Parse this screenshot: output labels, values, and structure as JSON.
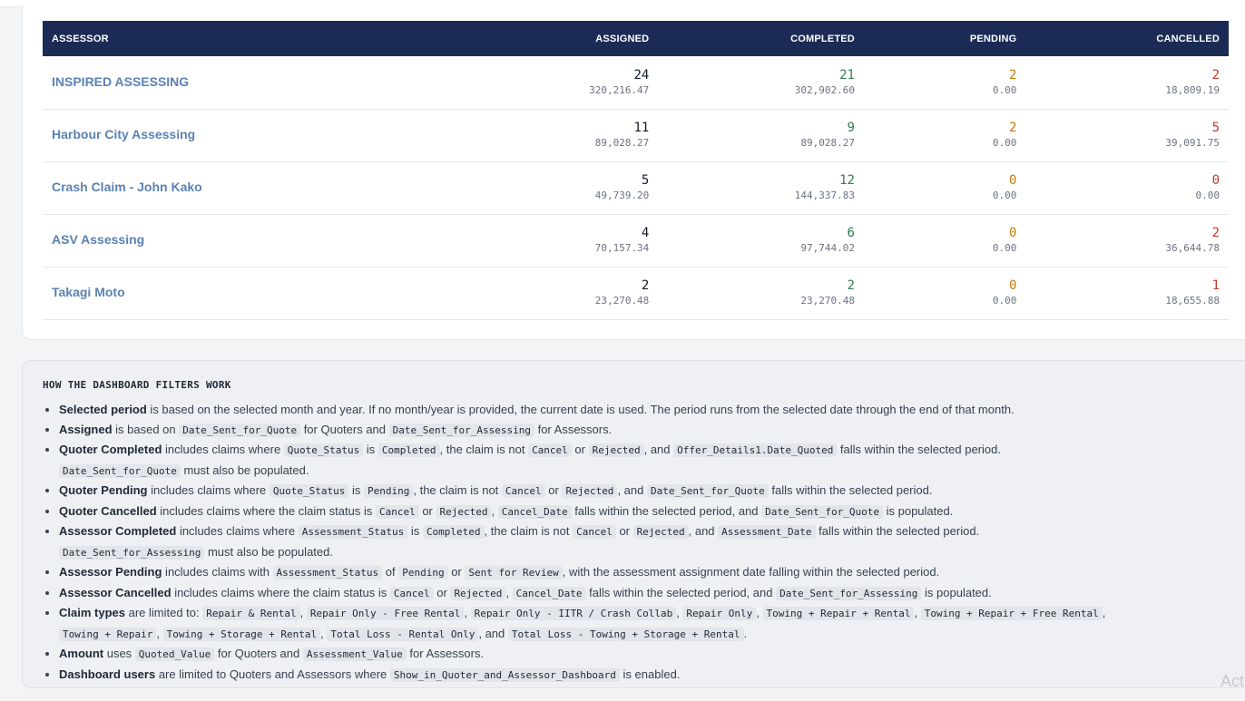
{
  "table": {
    "headers": {
      "assessor": "ASSESSOR",
      "assigned": "ASSIGNED",
      "completed": "COMPLETED",
      "pending": "PENDING",
      "cancelled": "CANCELLED"
    },
    "rows": [
      {
        "name": "INSPIRED ASSESSING",
        "assigned": {
          "count": "24",
          "amount": "320,216.47"
        },
        "completed": {
          "count": "21",
          "amount": "302,902.60"
        },
        "pending": {
          "count": "2",
          "amount": "0.00"
        },
        "cancelled": {
          "count": "2",
          "amount": "18,809.19"
        }
      },
      {
        "name": "Harbour City Assessing",
        "assigned": {
          "count": "11",
          "amount": "89,028.27"
        },
        "completed": {
          "count": "9",
          "amount": "89,028.27"
        },
        "pending": {
          "count": "2",
          "amount": "0.00"
        },
        "cancelled": {
          "count": "5",
          "amount": "39,091.75"
        }
      },
      {
        "name": "Crash Claim - John Kako",
        "assigned": {
          "count": "5",
          "amount": "49,739.20"
        },
        "completed": {
          "count": "12",
          "amount": "144,337.83"
        },
        "pending": {
          "count": "0",
          "amount": "0.00"
        },
        "cancelled": {
          "count": "0",
          "amount": "0.00"
        }
      },
      {
        "name": "ASV Assessing",
        "assigned": {
          "count": "4",
          "amount": "70,157.34"
        },
        "completed": {
          "count": "6",
          "amount": "97,744.02"
        },
        "pending": {
          "count": "0",
          "amount": "0.00"
        },
        "cancelled": {
          "count": "2",
          "amount": "36,644.78"
        }
      },
      {
        "name": "Takagi Moto",
        "assigned": {
          "count": "2",
          "amount": "23,270.48"
        },
        "completed": {
          "count": "2",
          "amount": "23,270.48"
        },
        "pending": {
          "count": "0",
          "amount": "0.00"
        },
        "cancelled": {
          "count": "1",
          "amount": "18,655.88"
        }
      }
    ]
  },
  "info": {
    "title": "HOW THE DASHBOARD FILTERS WORK",
    "rules": {
      "selected_period": {
        "label": "Selected period",
        "text": " is based on the selected month and year. If no month/year is provided, the current date is used. The period runs from the selected date through the end of that month."
      },
      "assigned": {
        "label": "Assigned",
        "t1": " is based on ",
        "c1": "Date_Sent_for_Quote",
        "t2": " for Quoters and ",
        "c2": "Date_Sent_for_Assessing",
        "t3": " for Assessors."
      },
      "quoter_completed": {
        "label": "Quoter Completed",
        "t1": " includes claims where ",
        "c1": "Quote_Status",
        "t2": " is ",
        "c2": "Completed",
        "t3": ", the claim is not ",
        "c3": "Cancel",
        "t4": " or ",
        "c4": "Rejected",
        "t5": ", and ",
        "c5": "Offer_Details1.Date_Quoted",
        "t6": " falls within the selected period.",
        "c6": "Date_Sent_for_Quote",
        "t7": " must also be populated."
      },
      "quoter_pending": {
        "label": "Quoter Pending",
        "t1": " includes claims where ",
        "c1": "Quote_Status",
        "t2": " is ",
        "c2": "Pending",
        "t3": ", the claim is not ",
        "c3": "Cancel",
        "t4": " or ",
        "c4": "Rejected",
        "t5": ", and ",
        "c5": "Date_Sent_for_Quote",
        "t6": " falls within the selected period."
      },
      "quoter_cancelled": {
        "label": "Quoter Cancelled",
        "t1": " includes claims where the claim status is ",
        "c1": "Cancel",
        "t2": " or ",
        "c2": "Rejected",
        "t3": ", ",
        "c3": "Cancel_Date",
        "t4": " falls within the selected period, and ",
        "c4": "Date_Sent_for_Quote",
        "t5": " is populated."
      },
      "assessor_completed": {
        "label": "Assessor Completed",
        "t1": " includes claims where ",
        "c1": "Assessment_Status",
        "t2": " is ",
        "c2": "Completed",
        "t3": ", the claim is not ",
        "c3": "Cancel",
        "t4": " or ",
        "c4": "Rejected",
        "t5": ", and ",
        "c5": "Assessment_Date",
        "t6": " falls within the selected period.",
        "c6": "Date_Sent_for_Assessing",
        "t7": " must also be populated."
      },
      "assessor_pending": {
        "label": "Assessor Pending",
        "t1": " includes claims with ",
        "c1": "Assessment_Status",
        "t2": " of ",
        "c2": "Pending",
        "t3": " or ",
        "c3": "Sent for Review",
        "t4": ", with the assessment assignment date falling within the selected period."
      },
      "assessor_cancelled": {
        "label": "Assessor Cancelled",
        "t1": " includes claims where the claim status is ",
        "c1": "Cancel",
        "t2": " or ",
        "c2": "Rejected",
        "t3": ", ",
        "c3": "Cancel_Date",
        "t4": " falls within the selected period, and ",
        "c4": "Date_Sent_for_Assessing",
        "t5": " is populated."
      },
      "claim_types": {
        "label": "Claim types",
        "t1": " are limited to: ",
        "c1": "Repair & Rental",
        "c2": "Repair Only - Free Rental",
        "c3": "Repair Only - IITR / Crash Collab",
        "c4": "Repair Only",
        "c5": "Towing + Repair + Rental",
        "c6": "Towing + Repair + Free Rental",
        "c7": "Towing + Repair",
        "c8": "Towing + Storage + Rental",
        "c9": "Total Loss - Rental Only",
        "c10": "Total Loss - Towing + Storage + Rental",
        "sep": ", ",
        "and": ", and ",
        "end": "."
      },
      "amount": {
        "label": "Amount",
        "t1": " uses ",
        "c1": "Quoted_Value",
        "t2": " for Quoters and ",
        "c2": "Assessment_Value",
        "t3": " for Assessors."
      },
      "dashboard_users": {
        "label": "Dashboard users",
        "t1": " are limited to Quoters and Assessors where ",
        "c1": "Show_in_Quoter_and_Assessor_Dashboard",
        "t2": " is enabled."
      }
    }
  },
  "watermark": "Act"
}
